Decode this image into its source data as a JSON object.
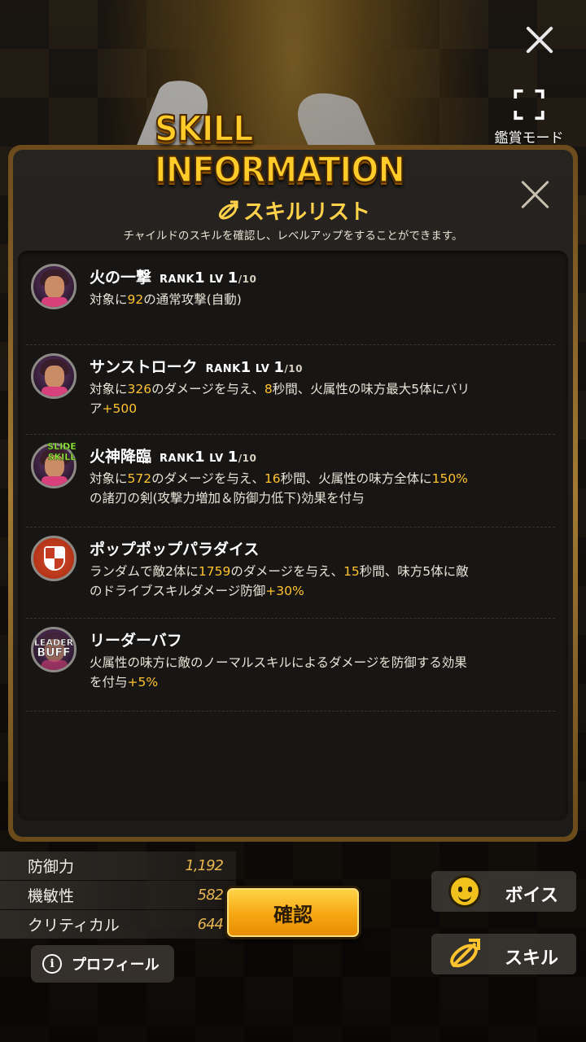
{
  "top": {
    "view_mode_label": "鑑賞モード"
  },
  "panel": {
    "title": "SKILL INFORMATION",
    "heading": "スキルリスト",
    "subheading": "チャイルドのスキルを確認し、レベルアップをすることができます。"
  },
  "skills": [
    {
      "name": "火の一撃",
      "rank_label": "RANK",
      "rank": "1",
      "lv_label": "LV",
      "lv": "1",
      "lv_max": "/10",
      "desc": [
        {
          "t": "対象に"
        },
        {
          "t": "92",
          "h": true
        },
        {
          "t": "の通常攻撃(自動)"
        }
      ]
    },
    {
      "name": "サンストローク",
      "rank_label": "RANK",
      "rank": "1",
      "lv_label": "LV",
      "lv": "1",
      "lv_max": "/10",
      "desc": [
        {
          "t": "対象に"
        },
        {
          "t": "326",
          "h": true
        },
        {
          "t": "のダメージを与え、"
        },
        {
          "t": "8",
          "h": true
        },
        {
          "t": "秒間、火属性の味方最大5体にバリア"
        },
        {
          "t": "+500",
          "h": true
        }
      ]
    },
    {
      "name": "火神降臨",
      "tag": "SLIDE SKILL",
      "rank_label": "RANK",
      "rank": "1",
      "lv_label": "LV",
      "lv": "1",
      "lv_max": "/10",
      "desc": [
        {
          "t": "対象に"
        },
        {
          "t": "572",
          "h": true
        },
        {
          "t": "のダメージを与え、"
        },
        {
          "t": "16",
          "h": true
        },
        {
          "t": "秒間、火属性の味方全体に"
        },
        {
          "t": "150%",
          "h": true
        },
        {
          "t": "の諸刃の剣(攻撃力増加＆防御力低下)効果を付与"
        }
      ]
    },
    {
      "name": "ポップポップパラダイス",
      "desc": [
        {
          "t": "ランダムで敵2体に"
        },
        {
          "t": "1759",
          "h": true
        },
        {
          "t": "のダメージを与え、"
        },
        {
          "t": "15",
          "h": true
        },
        {
          "t": "秒間、味方5体に敵のドライブスキルダメージ防御"
        },
        {
          "t": "+30%",
          "h": true
        }
      ]
    },
    {
      "name": "リーダーバフ",
      "tag_top": "LEADER",
      "tag_bottom": "BUFF",
      "desc": [
        {
          "t": "火属性の味方に敵のノーマルスキルによるダメージを防御する効果を付与"
        },
        {
          "t": "+5%",
          "h": true
        }
      ]
    }
  ],
  "stats": [
    {
      "label": "防御力",
      "value": "1,192"
    },
    {
      "label": "機敏性",
      "value": "582"
    },
    {
      "label": "クリティカル",
      "value": "644"
    }
  ],
  "buttons": {
    "confirm": "確認",
    "profile": "プロフィール",
    "voice": "ボイス",
    "skill": "スキル"
  },
  "colors": {
    "accent": "#ffc32e",
    "title": "#ffcc2a",
    "button": "#f6a712"
  }
}
